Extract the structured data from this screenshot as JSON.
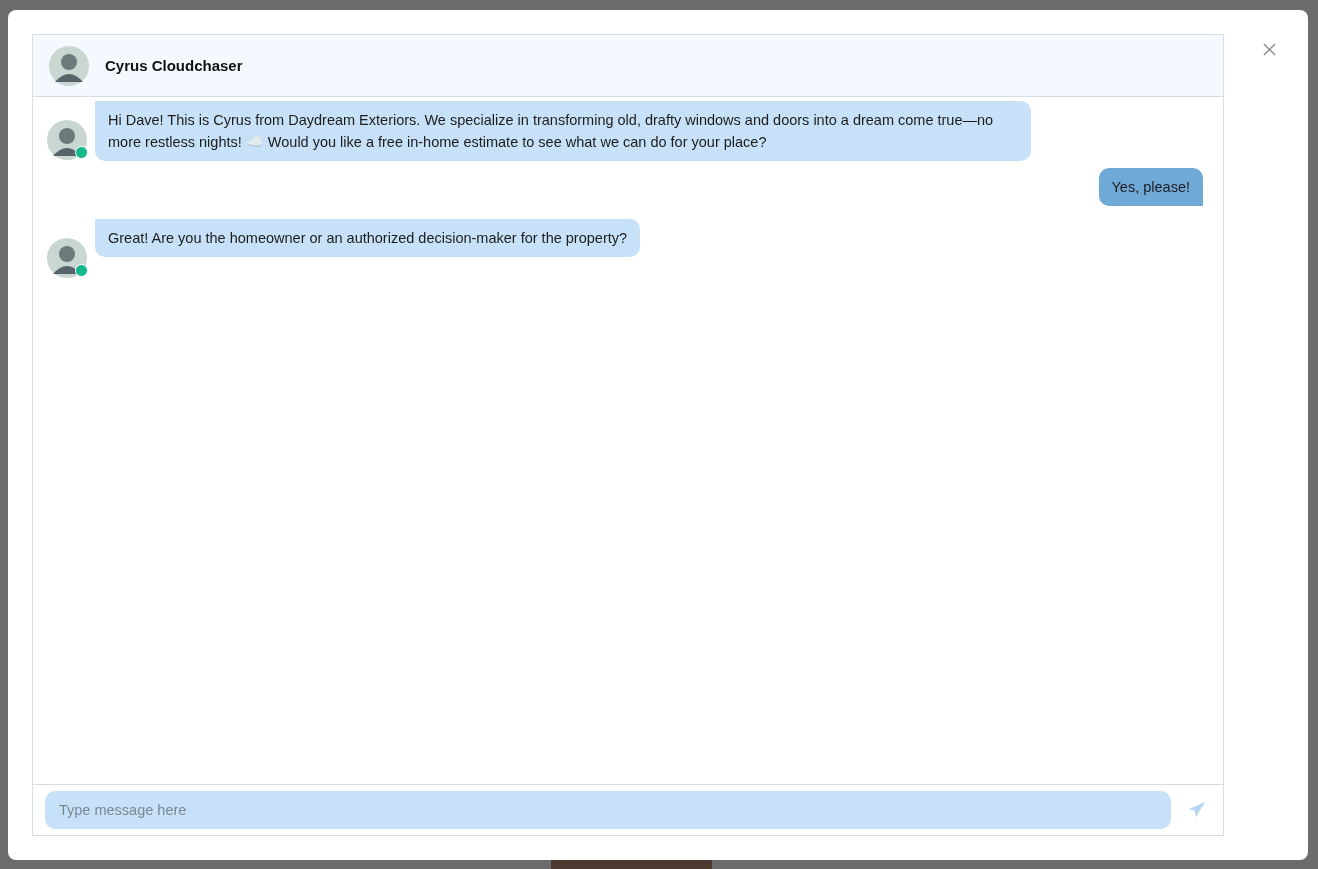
{
  "chat": {
    "contact_name": "Cyrus Cloudchaser",
    "messages": [
      {
        "kind": "incoming",
        "online": true,
        "text": "Hi Dave! This is Cyrus from Daydream Exteriors. We specialize in transforming old, drafty windows and doors into a dream come true—no more restless nights! ☁️ Would you like a free in-home estimate to see what we can do for your place?"
      },
      {
        "kind": "outgoing",
        "text": "Yes, please!"
      },
      {
        "kind": "incoming",
        "online": true,
        "text": "Great! Are you the homeowner or an authorized decision-maker for the property?"
      }
    ],
    "input": {
      "placeholder": "Type message here"
    }
  }
}
